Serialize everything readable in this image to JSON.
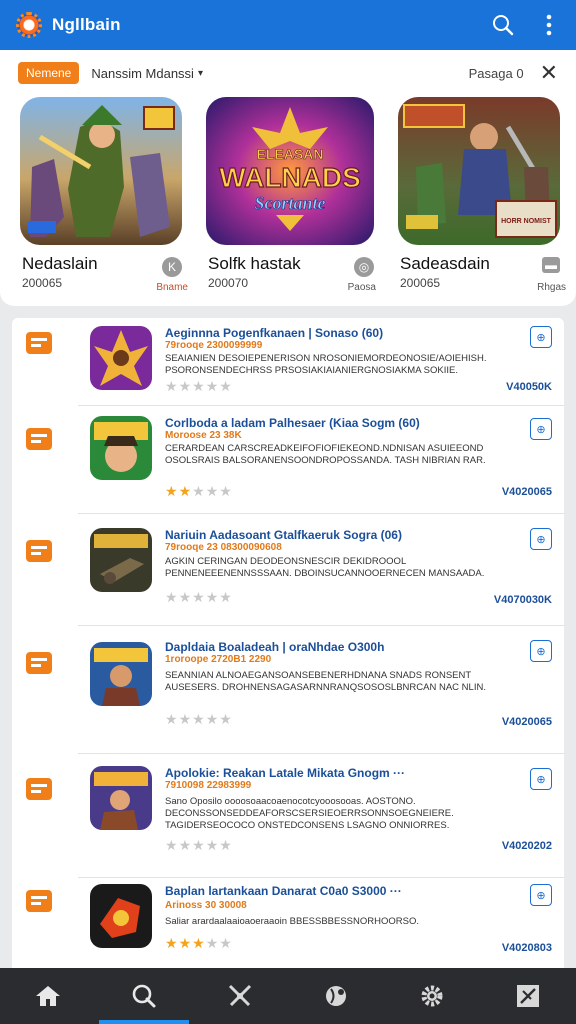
{
  "app": {
    "title": "Ngllbain",
    "colors": {
      "primary": "#1a73d9",
      "accent": "#f07f1a",
      "nav_bg": "#2b2c2f"
    },
    "icons": [
      "app-logo-icon",
      "search-icon",
      "more-vert-icon"
    ]
  },
  "filter": {
    "chip_label": "Nemene",
    "sort_label": "Nanssim Mdanssi",
    "sort_caret": "▾",
    "page_label": "Pasaga 0",
    "close_glyph": "✕"
  },
  "featured": [
    {
      "name": "Nedaslain",
      "count": "200065",
      "badge": "K",
      "tag": "Bname"
    },
    {
      "name": "Solfk hastak",
      "count": "200070",
      "badge": "◎",
      "tag": "Paosa",
      "art_title": "WALNADS",
      "art_top": "ELEASAN",
      "art_sub": "Scortante"
    },
    {
      "name": "Sadeasdain",
      "count": "200065",
      "badge": "▬",
      "tag": "Rhgas",
      "art_banner": "HORR NOMIST"
    }
  ],
  "list": [
    {
      "title": "Aeginnna Pogenfkanaen | Sonaso (60)",
      "meta": "79rooqe 2300099999",
      "desc": "SEAIANIEN DESOIEPENERISON NROSONIEMORDEONOSIE/AOIEHISH. PSORONSENDECHRSS PRSOSIAKIAIANIERGNOSIAKMA SOKIIE.",
      "rating": 0,
      "code": "V40050K",
      "action": "⊕"
    },
    {
      "title": "Corlboda a ladam Palhesaer (Kiaa Sogm (60)",
      "meta": "Moroose 23 38K",
      "desc": "CERARDEAN CARSCREADKEIFOFIOFIEKEOND.NDNISAN ASUIEEOND OSOLSRAIS BALSORANENSOONDROPOSSANDA. TASH NIBRIAN RAR.",
      "rating": 2,
      "code": "V4020065",
      "action": "⊕"
    },
    {
      "title": "Nariuin Aadasoant Gtalfkaeruk Sogra (06)",
      "meta": "79rooqe 23 08300090608",
      "desc": "AGKIN CERINGAN DEODEONSNESCIR DEKIDROOOL PENNENEEENENNSSSAAN. DBOINSUCANNOOERNECEN MANSAADA.",
      "rating": 0,
      "code": "V4070030K",
      "action": "⊕"
    },
    {
      "title": "Dapldaia Boaladeah | oraNhdae O300h",
      "meta": "1roroope 2720B1 2290",
      "desc": "SEANNIAN ALNOAEGANSOANSEBENERHDNANA SNADS RONSENT AUSESERS. DROHNENSAGASARNNRANQSOSOSLBNRCAN NAC NLIN.",
      "rating": 0,
      "code": "V4020065",
      "action": "⊕"
    },
    {
      "title": "Apolokie: Reakan Latale Mikata Gnogm ···",
      "meta": "7910098 22983999",
      "desc": "Sano Oposilo oooosoaacoaenocotcyooosooas. AOSTONO. DECONSSONSEDDEAFORSCSERSIEOERRSONNSOEGNEIERE. TAGIDERSEOCOCO ONSTEDCONSENS LSAGNO ONNIORRES.",
      "rating": 0,
      "code": "V4020202",
      "action": "⊕"
    },
    {
      "title": "Baplan lartankaan Danarat C0a0 S3000 ···",
      "meta": "Arinoss 30 30008",
      "desc": "Saliar arardaalaaioaoeraaoin BBESSBBESSNORHOORSO.",
      "rating": 3,
      "code": "V4020803",
      "action": "⊕"
    }
  ],
  "nav": [
    {
      "name": "nav-home",
      "icon": "home-icon"
    },
    {
      "name": "nav-search",
      "icon": "search-icon",
      "active": true
    },
    {
      "name": "nav-games",
      "icon": "swords-icon"
    },
    {
      "name": "nav-explore",
      "icon": "globe-icon"
    },
    {
      "name": "nav-settings",
      "icon": "gear-icon"
    },
    {
      "name": "nav-profile",
      "icon": "editor-icon"
    }
  ]
}
